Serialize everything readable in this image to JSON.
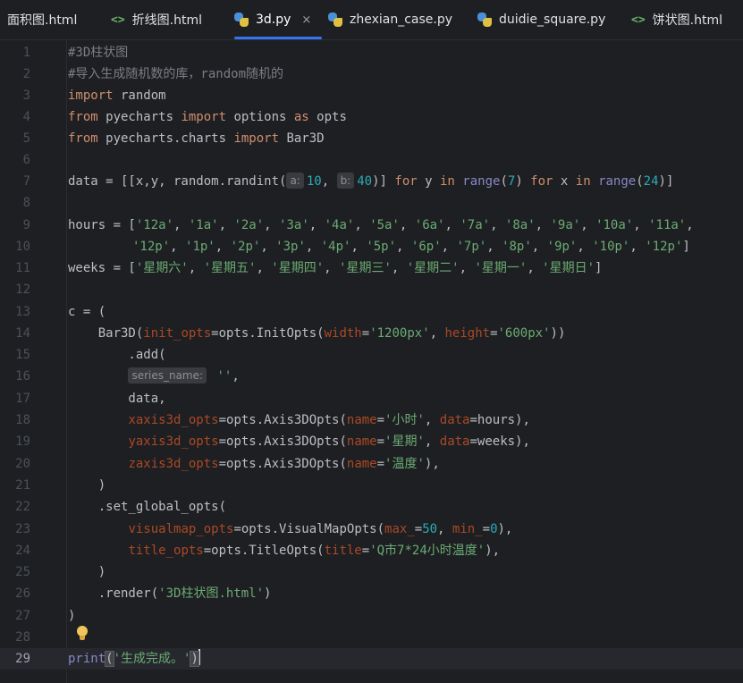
{
  "tabs": [
    {
      "label": "面积图.html",
      "type": "html",
      "active": false
    },
    {
      "label": "折线图.html",
      "type": "html",
      "active": false
    },
    {
      "label": "3d.py",
      "type": "py",
      "active": true
    },
    {
      "label": "zhexian_case.py",
      "type": "py",
      "active": false
    },
    {
      "label": "duidie_square.py",
      "type": "py",
      "active": false
    },
    {
      "label": "饼状图.html",
      "type": "html",
      "active": false
    }
  ],
  "tab_close_glyph": "×",
  "html_icon_glyph": "<>",
  "line_numbers": [
    "1",
    "2",
    "3",
    "4",
    "5",
    "6",
    "7",
    "8",
    "9",
    "10",
    "11",
    "12",
    "13",
    "14",
    "15",
    "16",
    "17",
    "18",
    "19",
    "20",
    "21",
    "22",
    "23",
    "24",
    "25",
    "26",
    "27",
    "28",
    "29"
  ],
  "current_line": "29",
  "code": {
    "l1": "#3D柱状图",
    "l2": "#导入生成随机数的库，random随机的",
    "l3_kw": "import",
    "l3_mod": " random",
    "l4_kw1": "from",
    "l4_mod": " pyecharts ",
    "l4_kw2": "import",
    "l4_name": " options ",
    "l4_kw3": "as",
    "l4_alias": " opts",
    "l5_kw1": "from",
    "l5_mod": " pyecharts.charts ",
    "l5_kw2": "import",
    "l5_name": " Bar3D",
    "l7_a": "data = [[x,y, random.randint(",
    "l7_hint_a": "a:",
    "l7_n1": "10",
    "l7_sep": ", ",
    "l7_hint_b": "b:",
    "l7_n2": "40",
    "l7_b": ")] ",
    "l7_for1": "for",
    "l7_y": " y ",
    "l7_in1": "in",
    "l7_sp1": " ",
    "l7_range1": "range",
    "l7_p1": "(",
    "l7_n3": "7",
    "l7_p2": ") ",
    "l7_for2": "for",
    "l7_x": " x ",
    "l7_in2": "in",
    "l7_sp2": " ",
    "l7_range2": "range",
    "l7_p3": "(",
    "l7_n4": "24",
    "l7_p4": ")]",
    "l9_a": "hours = [",
    "l9_items": [
      "'12a'",
      "'1a'",
      "'2a'",
      "'3a'",
      "'4a'",
      "'5a'",
      "'6a'",
      "'7a'",
      "'8a'",
      "'9a'",
      "'10a'",
      "'11a'"
    ],
    "l10_items": [
      "'12p'",
      "'1p'",
      "'2p'",
      "'3p'",
      "'4p'",
      "'5p'",
      "'6p'",
      "'7p'",
      "'8p'",
      "'9p'",
      "'10p'",
      "'12p'"
    ],
    "l11_a": "weeks = [",
    "l11_items": [
      "'星期六'",
      "'星期五'",
      "'星期四'",
      "'星期三'",
      "'星期二'",
      "'星期一'",
      "'星期日'"
    ],
    "l13": "c = (",
    "l14_a": "    Bar3D(",
    "l14_p1": "init_opts",
    "l14_b": "=opts.InitOpts(",
    "l14_p2": "width",
    "l14_eq1": "=",
    "l14_s1": "'1200px'",
    "l14_c": ", ",
    "l14_p3": "height",
    "l14_eq2": "=",
    "l14_s2": "'600px'",
    "l14_d": "))",
    "l15": "        .add(",
    "l16_indent": "        ",
    "l16_hint": "series_name:",
    "l16_s": " ''",
    "l16_c": ",",
    "l17": "        data,",
    "l18_indent": "        ",
    "l18_p1": "xaxis3d_opts",
    "l18_b": "=opts.Axis3DOpts(",
    "l18_p2": "name",
    "l18_eq": "=",
    "l18_s": "'小时'",
    "l18_c": ", ",
    "l18_p3": "data",
    "l18_d": "=hours),",
    "l19_indent": "        ",
    "l19_p1": "yaxis3d_opts",
    "l19_b": "=opts.Axis3DOpts(",
    "l19_p2": "name",
    "l19_eq": "=",
    "l19_s": "'星期'",
    "l19_c": ", ",
    "l19_p3": "data",
    "l19_d": "=weeks),",
    "l20_indent": "        ",
    "l20_p1": "zaxis3d_opts",
    "l20_b": "=opts.Axis3DOpts(",
    "l20_p2": "name",
    "l20_eq": "=",
    "l20_s": "'温度'",
    "l20_d": "),",
    "l21": "    )",
    "l22": "    .set_global_opts(",
    "l23_indent": "        ",
    "l23_p1": "visualmap_opts",
    "l23_b": "=opts.VisualMapOpts(",
    "l23_p2": "max_",
    "l23_eq1": "=",
    "l23_n1": "50",
    "l23_c": ", ",
    "l23_p3": "min_",
    "l23_eq2": "=",
    "l23_n2": "0",
    "l23_d": "),",
    "l24_indent": "        ",
    "l24_p1": "title_opts",
    "l24_b": "=opts.TitleOpts(",
    "l24_p2": "title",
    "l24_eq": "=",
    "l24_s": "'Q市7*24小时温度'",
    "l24_d": "),",
    "l25": "    )",
    "l26_a": "    .render(",
    "l26_s": "'3D柱状图.html'",
    "l26_b": ")",
    "l27": ")",
    "l29_fn": "print",
    "l29_p1": "(",
    "l29_s": "'生成完成。'",
    "l29_p2": ")"
  },
  "colors": {
    "bg": "#1e1f22",
    "keyword": "#cf8e6d",
    "string": "#6aab73",
    "number": "#2aacb8",
    "comment": "#7a7e85",
    "param": "#aa4926",
    "accent": "#3574f0"
  }
}
